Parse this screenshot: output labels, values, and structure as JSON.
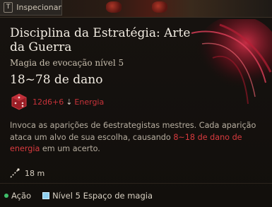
{
  "header": {
    "key_hint": "T",
    "inspect_label": "Inspecionar"
  },
  "spell": {
    "title": "Disciplina da Estratégia: Arte da Guerra",
    "subtitle": "Magia de evocação nível 5",
    "damage": "18~78 de dano",
    "dice": "12d6+6",
    "damage_type": "Energia",
    "description_pre": "Invoca as aparições de 6estrategistas mestres. Cada aparição ataca um alvo de sua escolha, causando ",
    "description_highlight": "8~18 de dano de energia",
    "description_post": " em um acerto.",
    "range": "18 m"
  },
  "footer": {
    "action_label": "Ação",
    "slot_label": "Nível 5 Espaço de magia"
  },
  "colors": {
    "damage_red": "#d93a3e",
    "action_green": "#3fbf6a",
    "slot_blue": "#8fd0f0"
  },
  "icons": {
    "key": "keyboard-key-icon",
    "die": "die-d6-icon",
    "arrow": "arrow-down-icon",
    "range": "range-icon",
    "action": "action-dot-icon",
    "slot": "spell-slot-icon"
  }
}
